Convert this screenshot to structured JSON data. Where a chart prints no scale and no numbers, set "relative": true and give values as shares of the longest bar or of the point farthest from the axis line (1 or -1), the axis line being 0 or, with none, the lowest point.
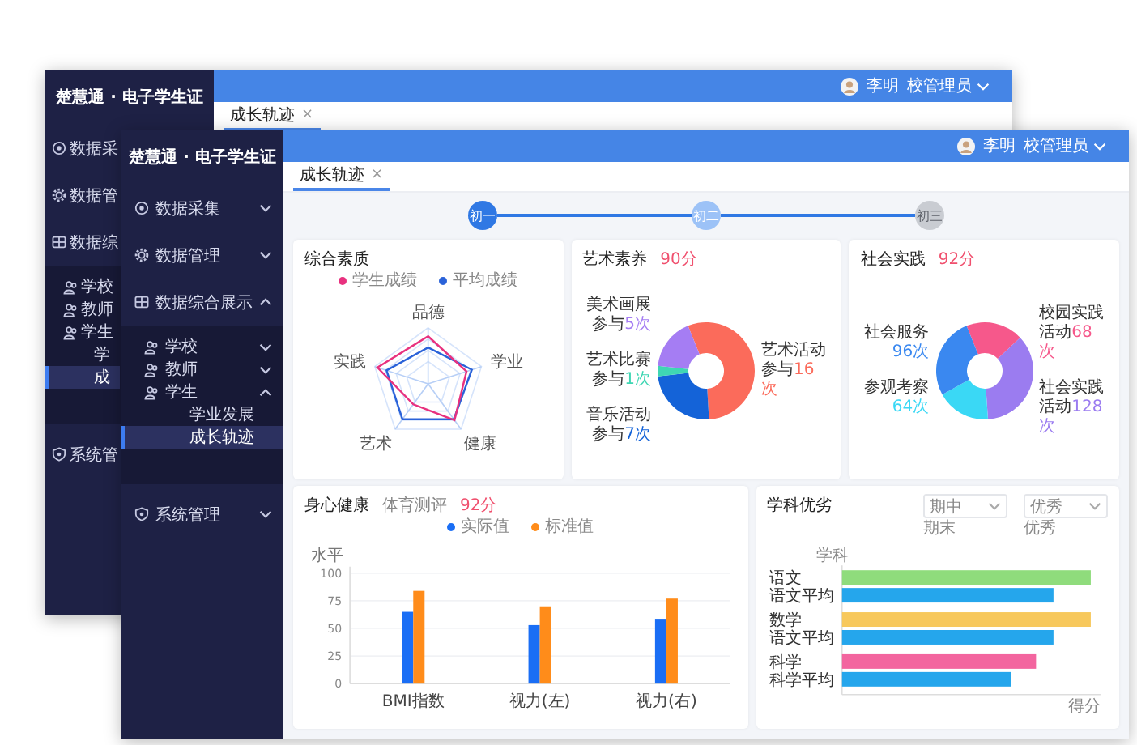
{
  "back_window": {
    "sidebar": {
      "title": "楚慧通 · 电子学生证",
      "items": [
        {
          "label": "数据采"
        },
        {
          "label": "数据管"
        },
        {
          "label": "数据综",
          "children": [
            {
              "label": "学校"
            },
            {
              "label": "教师"
            },
            {
              "label": "学生",
              "children": [
                {
                  "label": "学",
                  "selected": false
                },
                {
                  "label": "成",
                  "selected": true
                }
              ]
            }
          ]
        },
        {
          "label": "系统管"
        }
      ]
    },
    "user": {
      "name": "李明",
      "role": "校管理员"
    },
    "tabs": [
      {
        "label": "成长轨迹",
        "close": "×",
        "selected": true
      }
    ]
  },
  "front_window": {
    "sidebar": {
      "title": "楚慧通 · 电子学生证",
      "items": [
        {
          "label": "数据采集",
          "expanded": false
        },
        {
          "label": "数据管理",
          "expanded": false
        },
        {
          "label": "数据综合展示",
          "expanded": true,
          "children": [
            {
              "label": "学校",
              "expanded": false
            },
            {
              "label": "教师",
              "expanded": false
            },
            {
              "label": "学生",
              "expanded": true,
              "children": [
                {
                  "label": "学业发展",
                  "selected": false
                },
                {
                  "label": "成长轨迹",
                  "selected": true
                }
              ]
            }
          ]
        },
        {
          "label": "系统管理",
          "expanded": false
        }
      ]
    },
    "user": {
      "name": "李明",
      "role": "校管理员"
    },
    "tabs": [
      {
        "label": "成长轨迹",
        "close": "×",
        "selected": true
      }
    ],
    "steps": [
      {
        "label": "初一",
        "selected": true,
        "disabled": false
      },
      {
        "label": "初二",
        "selected": false,
        "disabled": false
      },
      {
        "label": "初三",
        "selected": false,
        "disabled": true
      }
    ],
    "quality": {
      "title": "综合素质",
      "legend": [
        {
          "label": "学生成绩",
          "color": "#e8317f"
        },
        {
          "label": "平均成绩",
          "color": "#2a62d9"
        }
      ],
      "axes": [
        "品德",
        "学业",
        "健康",
        "艺术",
        "实践"
      ]
    },
    "arts": {
      "title": "艺术素养",
      "score": "90分",
      "chart_data": {
        "type": "donut",
        "categories": [
          "艺术活动参与",
          "音乐活动参与",
          "艺术比赛参与",
          "美术画展参与"
        ],
        "values": [
          16,
          7,
          1,
          5
        ],
        "value_labels": [
          "16次",
          "7次",
          "1次",
          "5次"
        ],
        "colors": [
          "#fb6b5b",
          "#1463d8",
          "#3fd6b3",
          "#a57df3"
        ]
      }
    },
    "social": {
      "title": "社会实践",
      "score": "92分",
      "chart_data": {
        "type": "donut",
        "categories": [
          "校园实践活动",
          "社会实践活动",
          "参观考察",
          "社会服务"
        ],
        "values": [
          68,
          128,
          64,
          96
        ],
        "value_labels": [
          "68次",
          "128次",
          "64次",
          "96次"
        ],
        "colors": [
          "#f6588b",
          "#9b7cf0",
          "#3ad8f5",
          "#3a88f0"
        ]
      }
    },
    "health": {
      "title": "身心健康",
      "subtitle": "体育测评",
      "score": "92分",
      "chart_data": {
        "type": "bar",
        "grid": true,
        "ylabel": "水平",
        "categories": [
          "BMI指数",
          "视力(左)",
          "视力(右)"
        ],
        "ylim": [
          0,
          100
        ],
        "yticks": [
          0,
          25,
          50,
          75,
          100
        ],
        "series": [
          {
            "name": "实际值",
            "color": "#1a6ef5",
            "values": [
              65,
              53,
              58
            ]
          },
          {
            "name": "标准值",
            "color": "#ff8c1a",
            "values": [
              84,
              70,
              77
            ]
          }
        ]
      }
    },
    "subjects": {
      "title": "学科优劣",
      "filters": [
        {
          "value": "期中",
          "hint": "期末"
        },
        {
          "value": "优秀",
          "hint": "优秀"
        }
      ],
      "chart_data": {
        "type": "bar",
        "orientation": "horizontal",
        "ylabel": "学科",
        "xlabel": "得分",
        "relative": true,
        "categories": [
          "语文",
          "语文平均",
          "数学",
          "语文平均",
          "科学",
          "科学平均"
        ],
        "series": [
          {
            "color": "#8fdc7c",
            "values": [
              1,
              null,
              null,
              null,
              null,
              null
            ]
          },
          {
            "color": "#f7c85c",
            "values": [
              null,
              null,
              1,
              null,
              null,
              null
            ]
          },
          {
            "color": "#f3659f",
            "values": [
              null,
              null,
              null,
              null,
              0.78,
              null
            ]
          },
          {
            "color": "#25a6ec",
            "values": [
              null,
              0.85,
              null,
              0.85,
              null,
              0.68
            ]
          }
        ]
      }
    }
  }
}
